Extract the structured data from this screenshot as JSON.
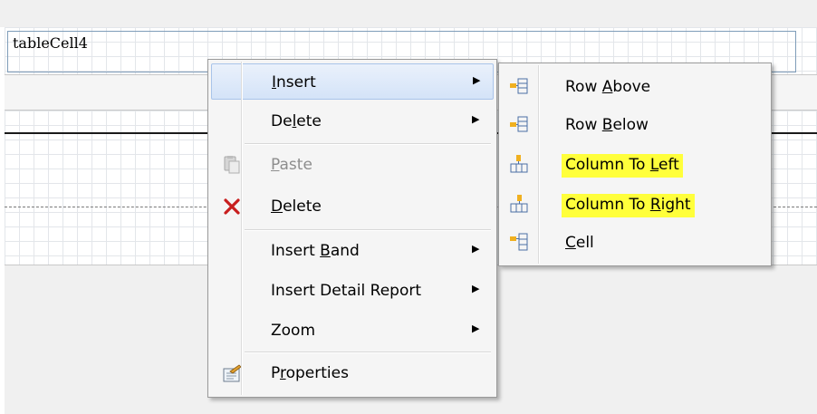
{
  "designer": {
    "cell_text": "tableCell4"
  },
  "context_menu": {
    "items": [
      {
        "label_pre": "",
        "label_key": "I",
        "label_post": "nsert",
        "has_submenu": true,
        "highlighted": true,
        "icon": ""
      },
      {
        "label_pre": "De",
        "label_key": "l",
        "label_post": "ete",
        "has_submenu": true,
        "icon": ""
      },
      {
        "label_pre": "",
        "label_key": "P",
        "label_post": "aste",
        "disabled": true,
        "icon": "paste-icon"
      },
      {
        "label_pre": "",
        "label_key": "D",
        "label_post": "elete",
        "icon": "delete-x-icon"
      },
      {
        "label_pre": "Insert ",
        "label_key": "B",
        "label_post": "and",
        "has_submenu": true,
        "icon": ""
      },
      {
        "label_pre": "Insert Detail Report",
        "label_key": "",
        "label_post": "",
        "has_submenu": true,
        "icon": ""
      },
      {
        "label_pre": "Zoom",
        "label_key": "",
        "label_post": "",
        "has_submenu": true,
        "icon": ""
      },
      {
        "label_pre": "P",
        "label_key": "r",
        "label_post": "operties",
        "icon": "properties-icon"
      }
    ],
    "submenu_arrow": "▶"
  },
  "insert_submenu": {
    "items": [
      {
        "label_pre": "Row ",
        "label_key": "A",
        "label_post": "bove",
        "icon": "row-above-icon",
        "marked": false
      },
      {
        "label_pre": "Row ",
        "label_key": "B",
        "label_post": "elow",
        "icon": "row-below-icon",
        "marked": false
      },
      {
        "label_pre": "Column To ",
        "label_key": "L",
        "label_post": "eft",
        "icon": "column-left-icon",
        "marked": true
      },
      {
        "label_pre": "Column To ",
        "label_key": "R",
        "label_post": "ight",
        "icon": "column-right-icon",
        "marked": true
      },
      {
        "label_pre": "",
        "label_key": "C",
        "label_post": "ell",
        "icon": "cell-icon",
        "marked": false
      }
    ]
  },
  "colors": {
    "highlight_marker": "#ffff3b",
    "delete_icon": "#c81e1e",
    "menu_background": "#f5f5f5"
  }
}
